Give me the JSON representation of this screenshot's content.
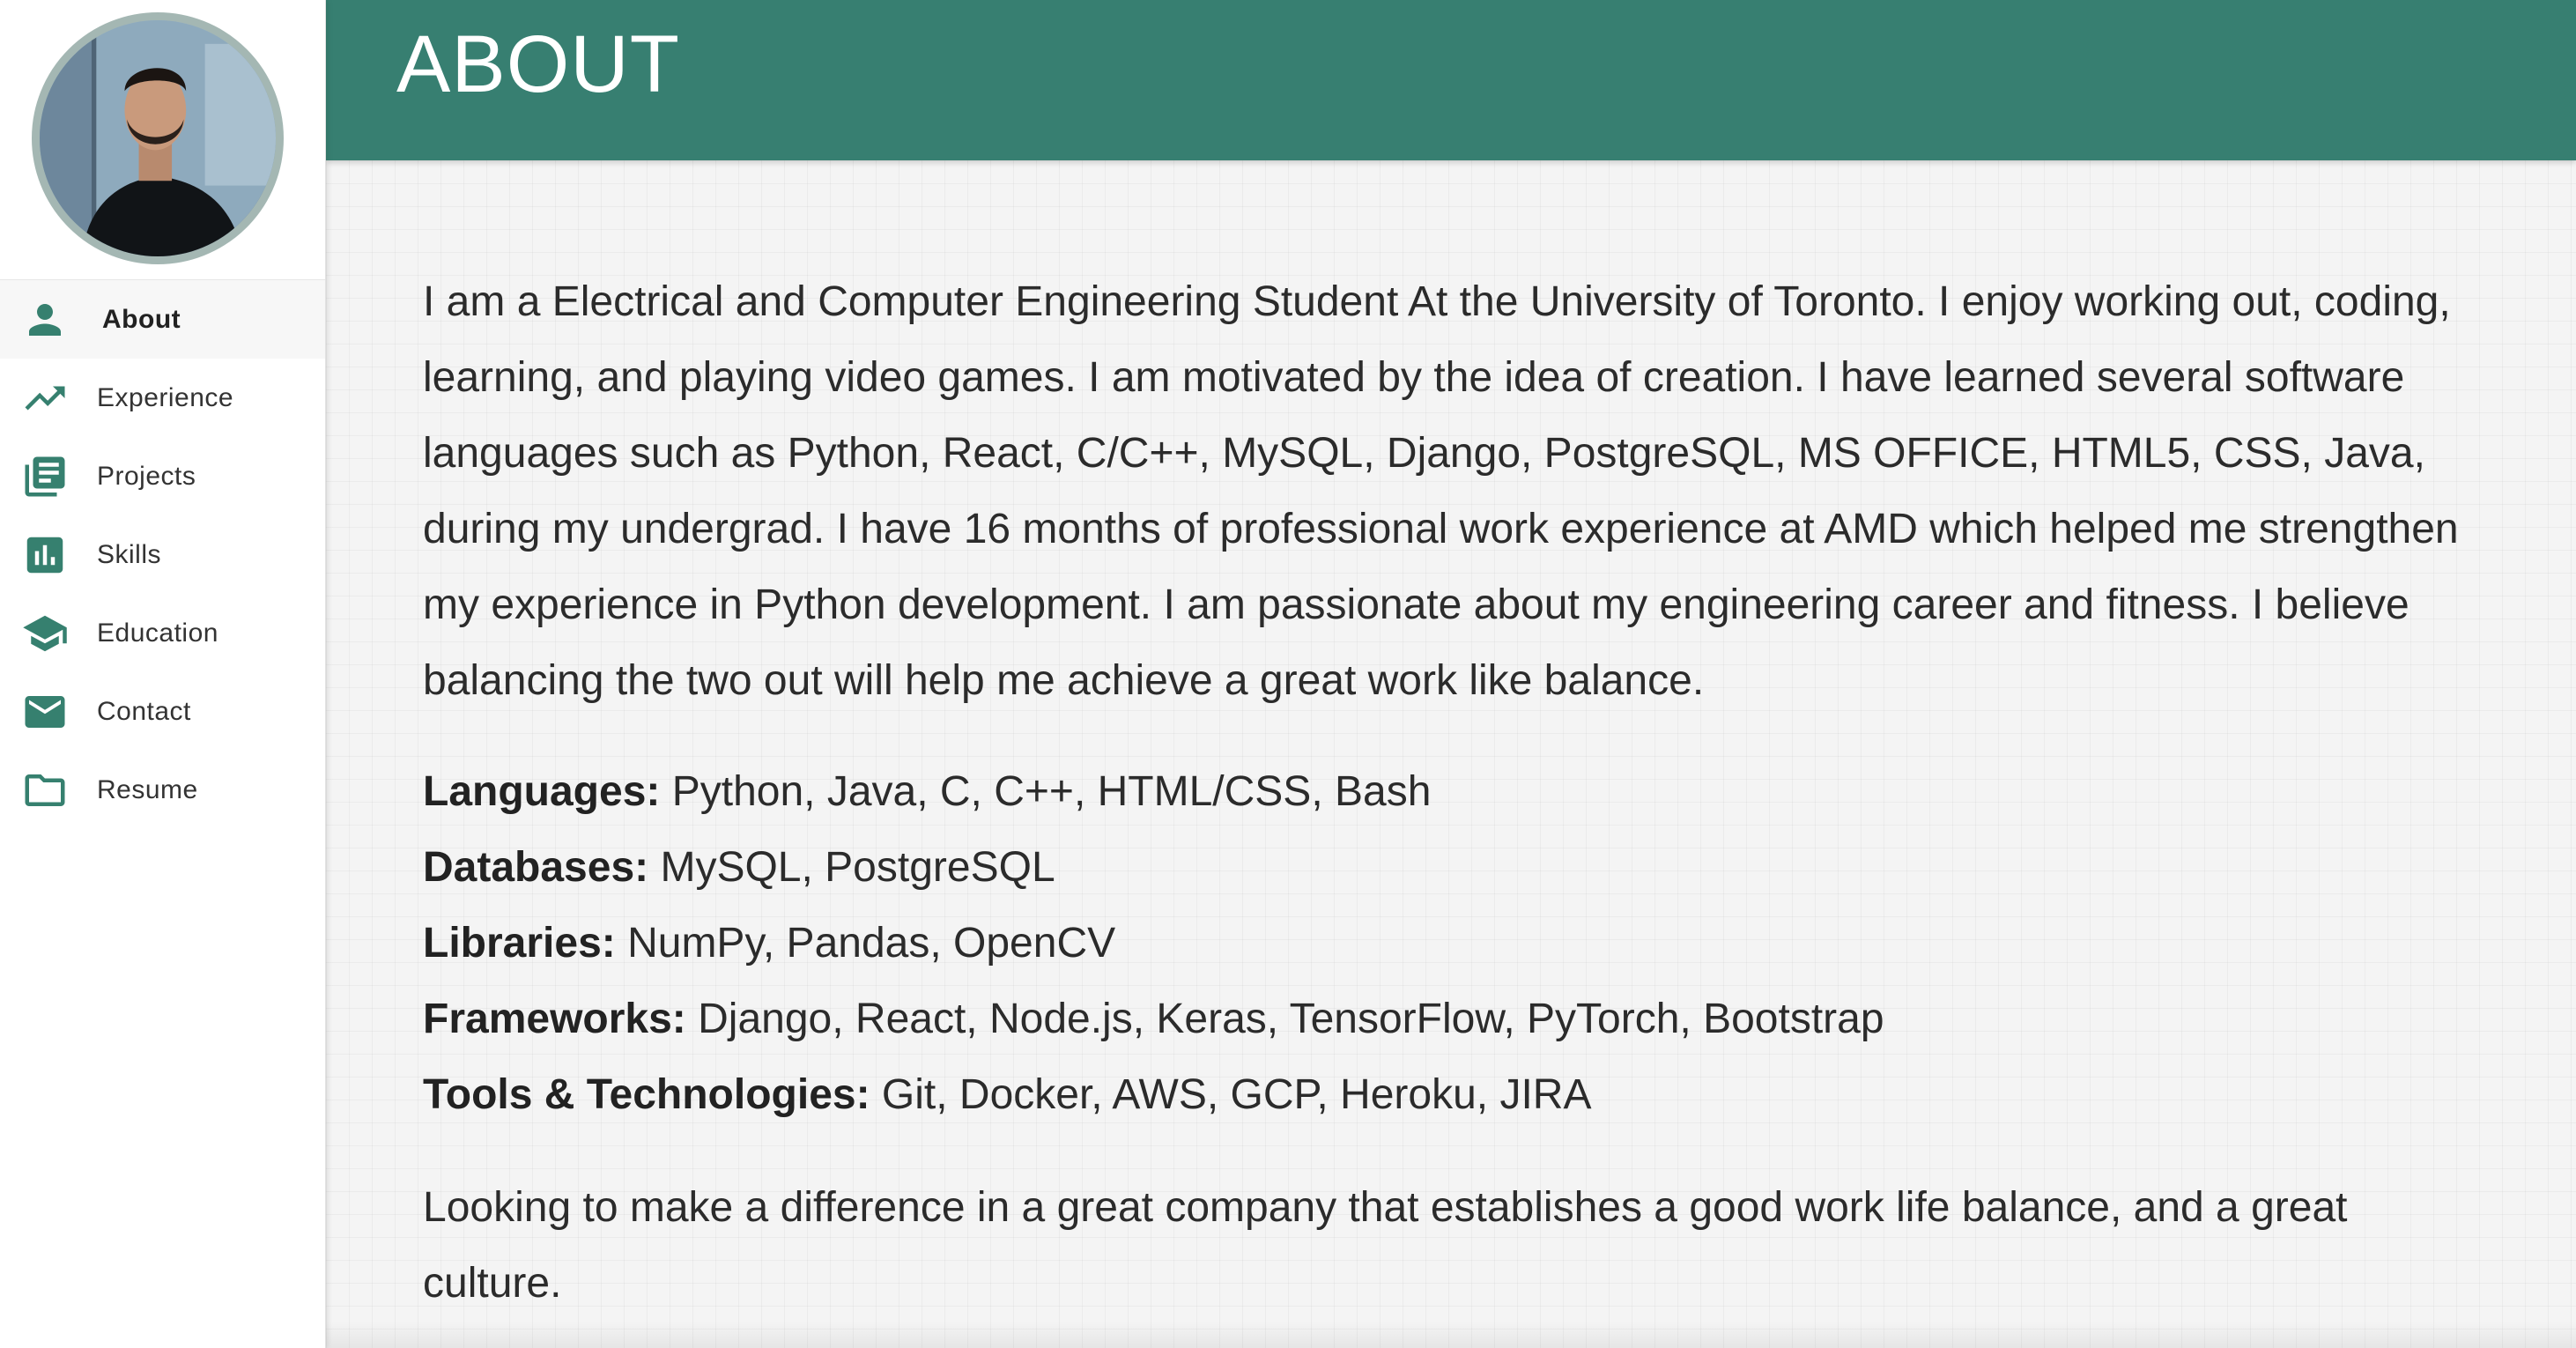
{
  "sidebar": {
    "avatar_alt": "Profile photo",
    "items": [
      {
        "label": "About",
        "icon": "person-icon",
        "active": true
      },
      {
        "label": "Experience",
        "icon": "trending-up-icon",
        "active": false
      },
      {
        "label": "Projects",
        "icon": "library-books-icon",
        "active": false
      },
      {
        "label": "Skills",
        "icon": "bar-chart-icon",
        "active": false
      },
      {
        "label": "Education",
        "icon": "graduation-cap-icon",
        "active": false
      },
      {
        "label": "Contact",
        "icon": "mail-icon",
        "active": false
      },
      {
        "label": "Resume",
        "icon": "folder-icon",
        "active": false
      }
    ]
  },
  "header": {
    "title": "ABOUT"
  },
  "main": {
    "intro": "I am a Electrical and Computer Engineering Student At the University of Toronto. I enjoy working out, coding, learning, and playing video games. I am motivated by the idea of creation. I have learned several software languages such as Python, React, C/C++, MySQL, Django, PostgreSQL, MS OFFICE, HTML5, CSS, Java, during my undergrad. I have 16 months of professional work experience at AMD which helped me strengthen my experience in Python development. I am passionate about my engineering career and fitness. I believe balancing the two out will help me achieve a great work like balance.",
    "skills": [
      {
        "key": "Languages:",
        "value": " Python, Java, C, C++, HTML/CSS, Bash"
      },
      {
        "key": "Databases:",
        "value": " MySQL, PostgreSQL"
      },
      {
        "key": "Libraries:",
        "value": " NumPy, Pandas, OpenCV"
      },
      {
        "key": "Frameworks:",
        "value": " Django, React, Node.js, Keras, TensorFlow, PyTorch, Bootstrap"
      },
      {
        "key": "Tools & Technologies:",
        "value": " Git, Docker, AWS, GCP, Heroku, JIRA"
      }
    ],
    "closing": "Looking to make a difference in a great company that establishes a good work life balance, and a great culture."
  },
  "colors": {
    "accent": "#377f71",
    "icon": "#36806f",
    "avatar_border": "#a4b7b3"
  }
}
